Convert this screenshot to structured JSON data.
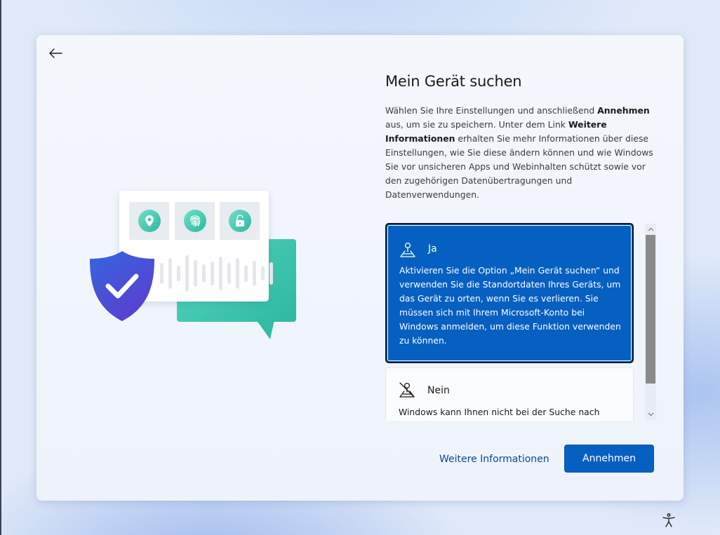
{
  "page": {
    "title": "Mein Gerät suchen",
    "description": {
      "part1": "Wählen Sie Ihre Einstellungen und anschließend ",
      "bold1": "Annehmen",
      "part2": " aus, um sie zu speichern. Unter dem Link ",
      "bold2": "Weitere Informationen",
      "part3": " erhalten Sie mehr Informationen über diese Einstellungen, wie Sie diese ändern können und wie Windows Sie vor unsicheren Apps und Webinhalten schützt sowie vor den zugehörigen Datenübertragungen und Datenverwendungen."
    }
  },
  "options": [
    {
      "label": "Ja",
      "icon": "location-pin-icon",
      "description": "Aktivieren Sie die Option „Mein Gerät suchen“ und verwenden Sie die Standortdaten Ihres Geräts, um das Gerät zu orten, wenn Sie es verlieren. Sie müssen sich mit Ihrem Microsoft-Konto bei Windows anmelden, um diese Funktion verwenden zu können.",
      "selected": true
    },
    {
      "label": "Nein",
      "icon": "location-off-icon",
      "description": "Windows kann Ihnen nicht bei der Suche nach",
      "selected": false
    }
  ],
  "footer": {
    "more_info": "Weitere Informationen",
    "accept": "Annehmen"
  },
  "colors": {
    "accent": "#0560c1",
    "teal": "#2fb8a2",
    "shield": "#3d4fd8"
  }
}
